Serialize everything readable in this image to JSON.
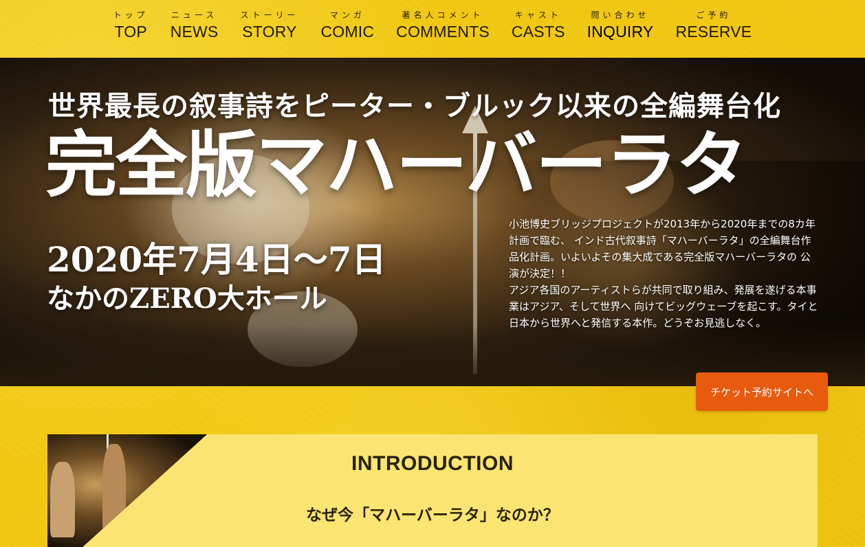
{
  "nav": {
    "items": [
      {
        "kana": "トップ",
        "label": "TOP"
      },
      {
        "kana": "ニュース",
        "label": "NEWS"
      },
      {
        "kana": "ストーリー",
        "label": "STORY"
      },
      {
        "kana": "マンガ",
        "label": "COMIC"
      },
      {
        "kana": "著名人コメント",
        "label": "COMMENTS"
      },
      {
        "kana": "キャスト",
        "label": "CASTS"
      },
      {
        "kana": "問い合わせ",
        "label": "INQUIRY"
      },
      {
        "kana": "ご予約",
        "label": "RESERVE"
      }
    ]
  },
  "hero": {
    "subtitle": "世界最長の叙事詩をピーター・ブルック以来の全編舞台化",
    "title": "完全版マハーバーラタ",
    "date": "2020年7月4日～7日",
    "venue": "なかのZERO大ホール",
    "description_1": "小池博史ブリッジプロジェクトが2013年から2020年までの8カ年計画で臨む、 インド古代叙事詩「マハーバーラタ」の全編舞台作品化計画。いよいよその集大成である完全版マハーバーラタの 公演が決定！！",
    "description_2": "アジア各国のアーティストらが共同で取り組み、発展を遂げる本事業はアジア、そして世界へ 向けてビッグウェーブを起こす。タイと日本から世界へと発信する本作。どうぞお見逃しなく。"
  },
  "ticket_button": "チケット予約サイトへ",
  "intro": {
    "title": "INTRODUCTION",
    "heading": "なぜ今「マハーバーラタ」なのか？"
  },
  "colors": {
    "background": "#f2cc17",
    "button": "#e85a0e",
    "intro_panel": "#fbe572"
  }
}
